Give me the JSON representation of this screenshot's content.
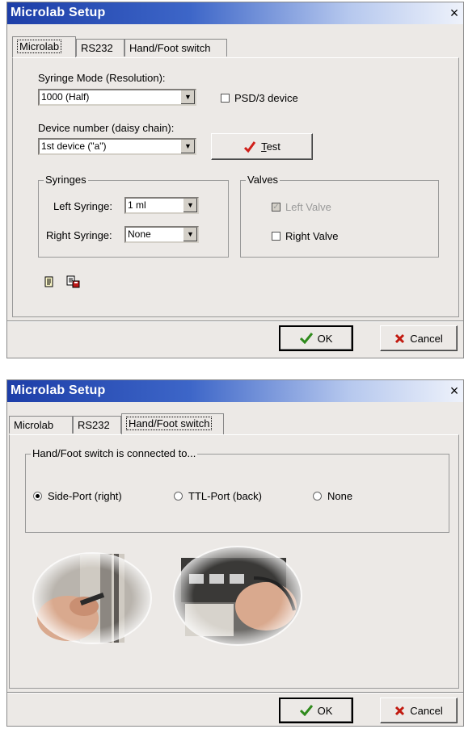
{
  "dialog1": {
    "title": "Microlab Setup",
    "close": "×",
    "tabs": [
      "Microlab",
      "RS232",
      "Hand/Foot switch"
    ],
    "active_tab": "Microlab",
    "syringe_mode_label": "Syringe Mode (Resolution):",
    "syringe_mode_value": "1000 (Half)",
    "psd3_label": "PSD/3 device",
    "psd3_checked": false,
    "device_number_label": "Device number (daisy chain):",
    "device_number_value": "1st device (\"a\")",
    "test_button_first": "T",
    "test_button_rest": "est",
    "syringes_group": "Syringes",
    "left_syringe_label": "Left Syringe:",
    "left_syringe_value": "1 ml",
    "right_syringe_label": "Right Syringe:",
    "right_syringe_value": "None",
    "valves_group": "Valves",
    "left_valve_label": "Left Valve",
    "left_valve_checked": true,
    "left_valve_disabled": true,
    "right_valve_label": "Right Valve",
    "right_valve_checked": false,
    "ok": "OK",
    "cancel": "Cancel"
  },
  "dialog2": {
    "title": "Microlab Setup",
    "close": "×",
    "tabs": [
      "Microlab",
      "RS232",
      "Hand/Foot switch"
    ],
    "active_tab": "Hand/Foot switch",
    "group_label": "Hand/Foot switch is connected to...",
    "radio_options": [
      "Side-Port (right)",
      "TTL-Port (back)",
      "None"
    ],
    "selected": "Side-Port (right)",
    "ok": "OK",
    "cancel": "Cancel"
  },
  "colors": {
    "titlebar_start": "#1d3ea8",
    "dialog_bg": "#ece9e6",
    "ok_check": "#2f8a1c",
    "cancel_x": "#c21a10",
    "test_check": "#d0201a"
  }
}
